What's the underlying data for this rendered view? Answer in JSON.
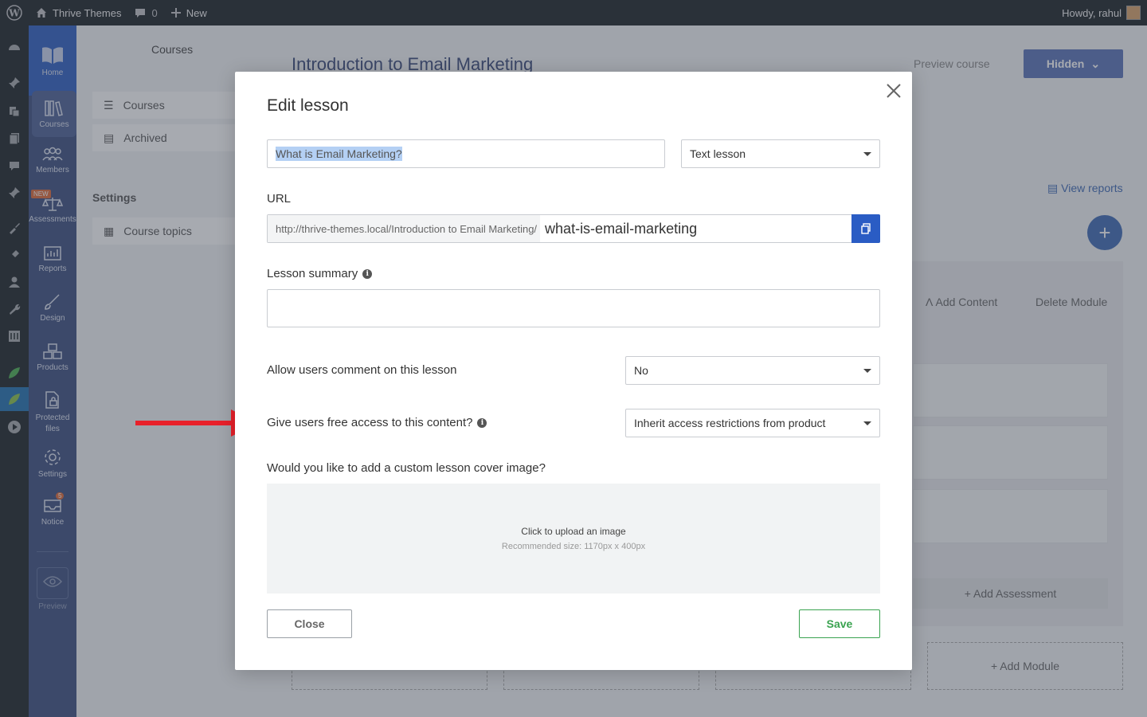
{
  "adminbar": {
    "site_name": "Thrive Themes",
    "comments_count": "0",
    "new_label": "New",
    "greeting": "Howdy, rahul"
  },
  "thrive_nav": {
    "items": [
      {
        "label": "Home",
        "icon": "book-icon"
      },
      {
        "label": "Courses",
        "icon": "books-icon"
      },
      {
        "label": "Members",
        "icon": "users-icon"
      },
      {
        "label": "Assessments",
        "icon": "scale-icon",
        "badge": "NEW"
      },
      {
        "label": "Reports",
        "icon": "chart-icon"
      },
      {
        "label": "Design",
        "icon": "brush-icon"
      },
      {
        "label": "Products",
        "icon": "boxes-icon"
      },
      {
        "label": "Protected files",
        "icon": "file-lock-icon"
      },
      {
        "label": "Settings",
        "icon": "gear-icon"
      },
      {
        "label": "Notice",
        "icon": "inbox-icon",
        "badge": "5"
      },
      {
        "label": "Preview",
        "icon": "eye-icon"
      }
    ]
  },
  "subpanel": {
    "title": "Courses",
    "items": [
      {
        "label": "Courses",
        "icon": "list-icon"
      },
      {
        "label": "Archived",
        "icon": "archive-icon"
      }
    ],
    "settings_heading": "Settings",
    "settings_items": [
      {
        "label": "Course topics",
        "icon": "grid-icon"
      }
    ]
  },
  "course": {
    "title": "Introduction to Email Marketing",
    "preview_link": "Preview course",
    "status_button": "Hidden",
    "view_reports": "View reports",
    "add_content": "Add Content",
    "delete_module": "Delete Module",
    "add_assessment": "+ Add Assessment",
    "add_module": "+ Add Module"
  },
  "modal": {
    "title": "Edit lesson",
    "lesson_title_value": "What is Email Marketing?",
    "lesson_type": "Text lesson",
    "url_label": "URL",
    "url_prefix": "http://thrive-themes.local/Introduction to Email Marketing/",
    "url_slug": "what-is-email-marketing",
    "summary_label": "Lesson summary",
    "comments_label": "Allow users comment on this lesson",
    "comments_value": "No",
    "free_access_label": "Give users free access to this content?",
    "free_access_value": "Inherit access restrictions from product",
    "cover_label": "Would you like to add a custom lesson cover image?",
    "upload_text": "Click to upload an image",
    "upload_hint": "Recommended size: 1170px x 400px",
    "close_button": "Close",
    "save_button": "Save"
  },
  "colors": {
    "wp_dark": "#1d2327",
    "thrive_sidebar": "#3d4f80",
    "accent_blue": "#2a5cc4",
    "save_green": "#3aa350",
    "arrow_red": "#e8202a"
  }
}
